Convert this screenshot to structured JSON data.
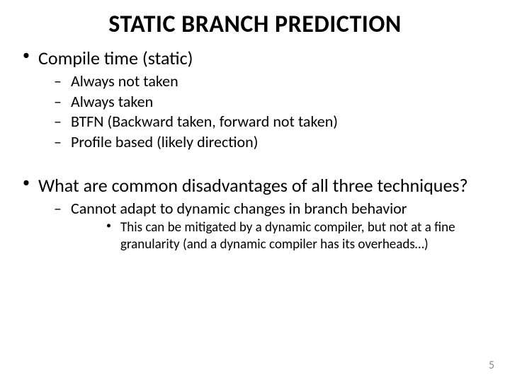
{
  "title": "STATIC BRANCH PREDICTION",
  "bullets": {
    "b1": {
      "text": "Compile time (static)",
      "sub": {
        "s1": "Always not taken",
        "s2": "Always taken",
        "s3": "BTFN (Backward taken, forward not taken)",
        "s4": "Profile based (likely direction)"
      }
    },
    "b2": {
      "text": "What are common disadvantages of all three techniques?",
      "sub": {
        "s1": "Cannot adapt to dynamic changes in branch behavior",
        "sub2": {
          "t1": "This can be mitigated by a dynamic compiler, but not at a fine granularity (and a dynamic compiler has its overheads…)"
        }
      }
    }
  },
  "page_number": "5"
}
